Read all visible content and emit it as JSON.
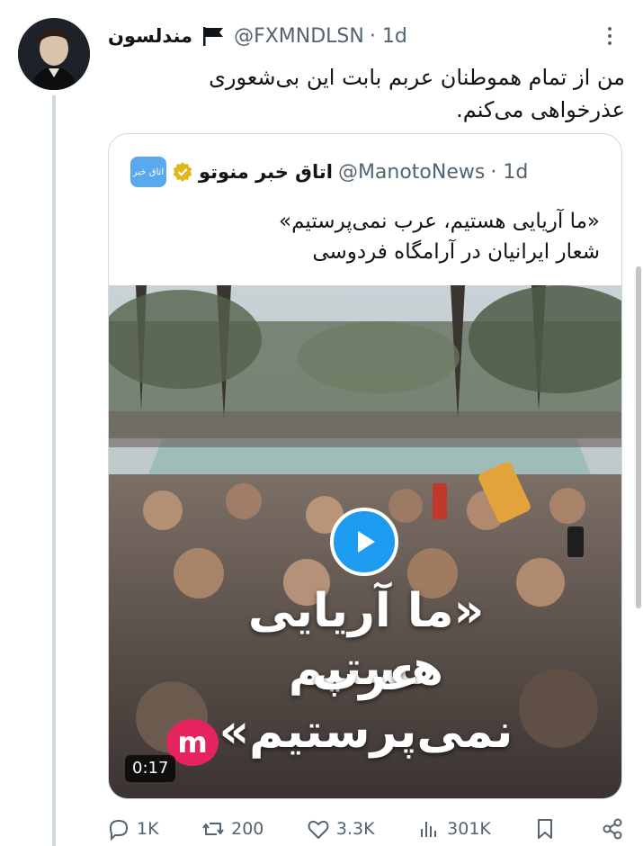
{
  "tweet": {
    "author_name": "مندلسون",
    "handle": "@FXMNDLSN",
    "time": "· 1d",
    "text_line1": "من از تمام هموطنان عربم بابت این بی‌شعوری",
    "text_line2": "عذرخواهی می‌کنم."
  },
  "quote": {
    "logo_text": "اتاق خبر",
    "author_name": "اتاق خبر منوتو",
    "handle": "@ManotoNews",
    "time": "· 1d",
    "text_line1": "«ما آریایی هستیم، عرب نمی‌پرستیم»",
    "text_line2": "شعار ایرانیان در آرامگاه فردوسی",
    "video": {
      "overlay_line1": "«ما آریایی هستیم",
      "overlay_line2": "عرب نمی‌پرستیم»",
      "duration": "0:17",
      "logo_letter": "m"
    }
  },
  "actions": {
    "replies": "1K",
    "reposts": "200",
    "likes": "3.3K",
    "views": "301K"
  },
  "icons": [
    "more-icon",
    "flag-icon",
    "verified-icon",
    "play-icon",
    "reply-icon",
    "repost-icon",
    "like-icon",
    "views-icon",
    "bookmark-icon",
    "share-icon"
  ],
  "colors": {
    "accent": "#1d9bf0",
    "secondary_text": "#536471",
    "verified": "#e2b719",
    "manoto_red": "#e5245f"
  }
}
